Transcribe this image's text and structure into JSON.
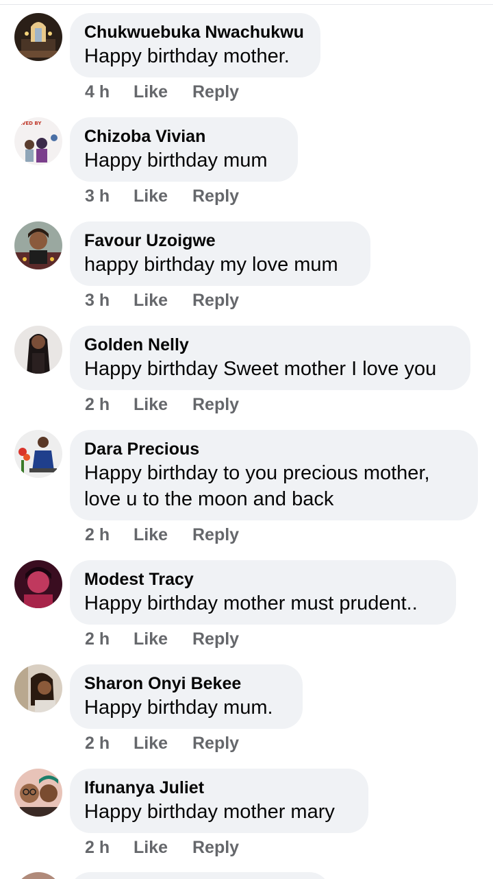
{
  "comments": [
    {
      "author": "Chukwuebuka Nwachukwu",
      "text": "Happy birthday mother.",
      "time": "4 h",
      "like": "Like",
      "reply": "Reply",
      "avatar": "church-interior-avatar"
    },
    {
      "author": "Chizoba Vivian",
      "text": "Happy birthday mum",
      "time": "3 h",
      "like": "Like",
      "reply": "Reply",
      "avatar": "couple-banner-avatar"
    },
    {
      "author": "Favour Uzoigwe",
      "text": "happy birthday my love mum",
      "time": "3 h",
      "like": "Like",
      "reply": "Reply",
      "avatar": "woman-portrait-avatar"
    },
    {
      "author": "Golden Nelly",
      "text": "Happy birthday Sweet mother I love you",
      "time": "2 h",
      "like": "Like",
      "reply": "Reply",
      "avatar": "woman-long-hair-avatar"
    },
    {
      "author": "Dara Precious",
      "text_line1": "Happy birthday to you precious mother,",
      "text_line2": "love u to the moon and back",
      "time": "2 h",
      "like": "Like",
      "reply": "Reply",
      "avatar": "woman-seated-flowers-avatar"
    },
    {
      "author": "Modest Tracy",
      "text": "Happy birthday mother must prudent..",
      "time": "2 h",
      "like": "Like",
      "reply": "Reply",
      "avatar": "woman-pink-filter-avatar"
    },
    {
      "author": "Sharon Onyi Bekee",
      "text": "Happy birthday mum.",
      "time": "2 h",
      "like": "Like",
      "reply": "Reply",
      "avatar": "woman-braids-avatar"
    },
    {
      "author": "Ifunanya Juliet",
      "text": "Happy birthday mother mary",
      "time": "2 h",
      "like": "Like",
      "reply": "Reply",
      "avatar": "two-women-selfie-avatar"
    }
  ]
}
